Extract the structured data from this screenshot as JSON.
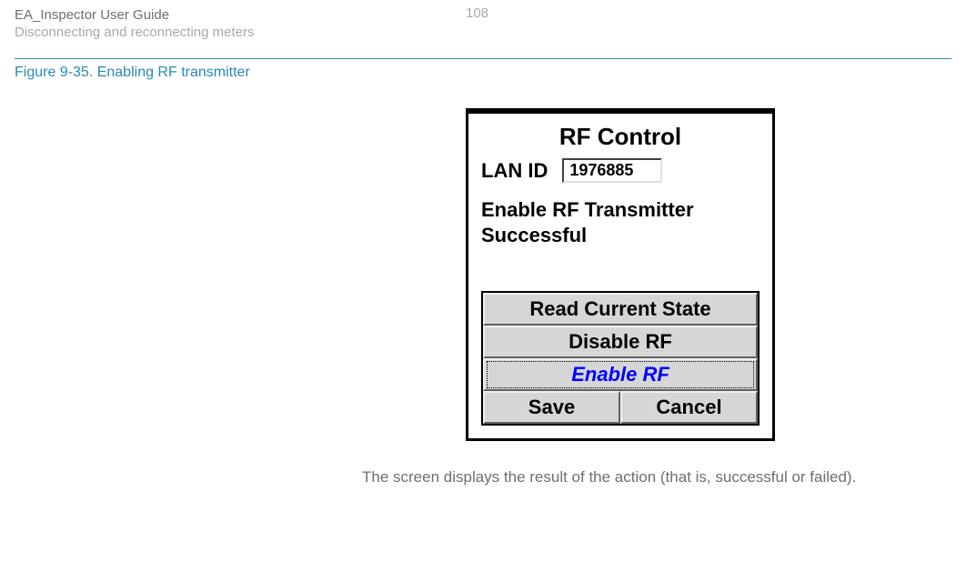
{
  "header": {
    "title": "EA_Inspector User Guide",
    "subtitle": "Disconnecting and reconnecting meters",
    "page_number": "108"
  },
  "figure": {
    "caption": "Figure 9-35. Enabling RF transmitter"
  },
  "device": {
    "title": "RF Control",
    "lan_label": "LAN ID",
    "lan_value": "1976885",
    "status_line1": "Enable RF Transmitter",
    "status_line2": "Successful",
    "buttons": {
      "read_state": "Read Current State",
      "disable_rf": "Disable RF",
      "enable_rf": "Enable RF",
      "save": "Save",
      "cancel": "Cancel"
    }
  },
  "body_text": "The screen displays the result of the action (that is, successful or failed)."
}
